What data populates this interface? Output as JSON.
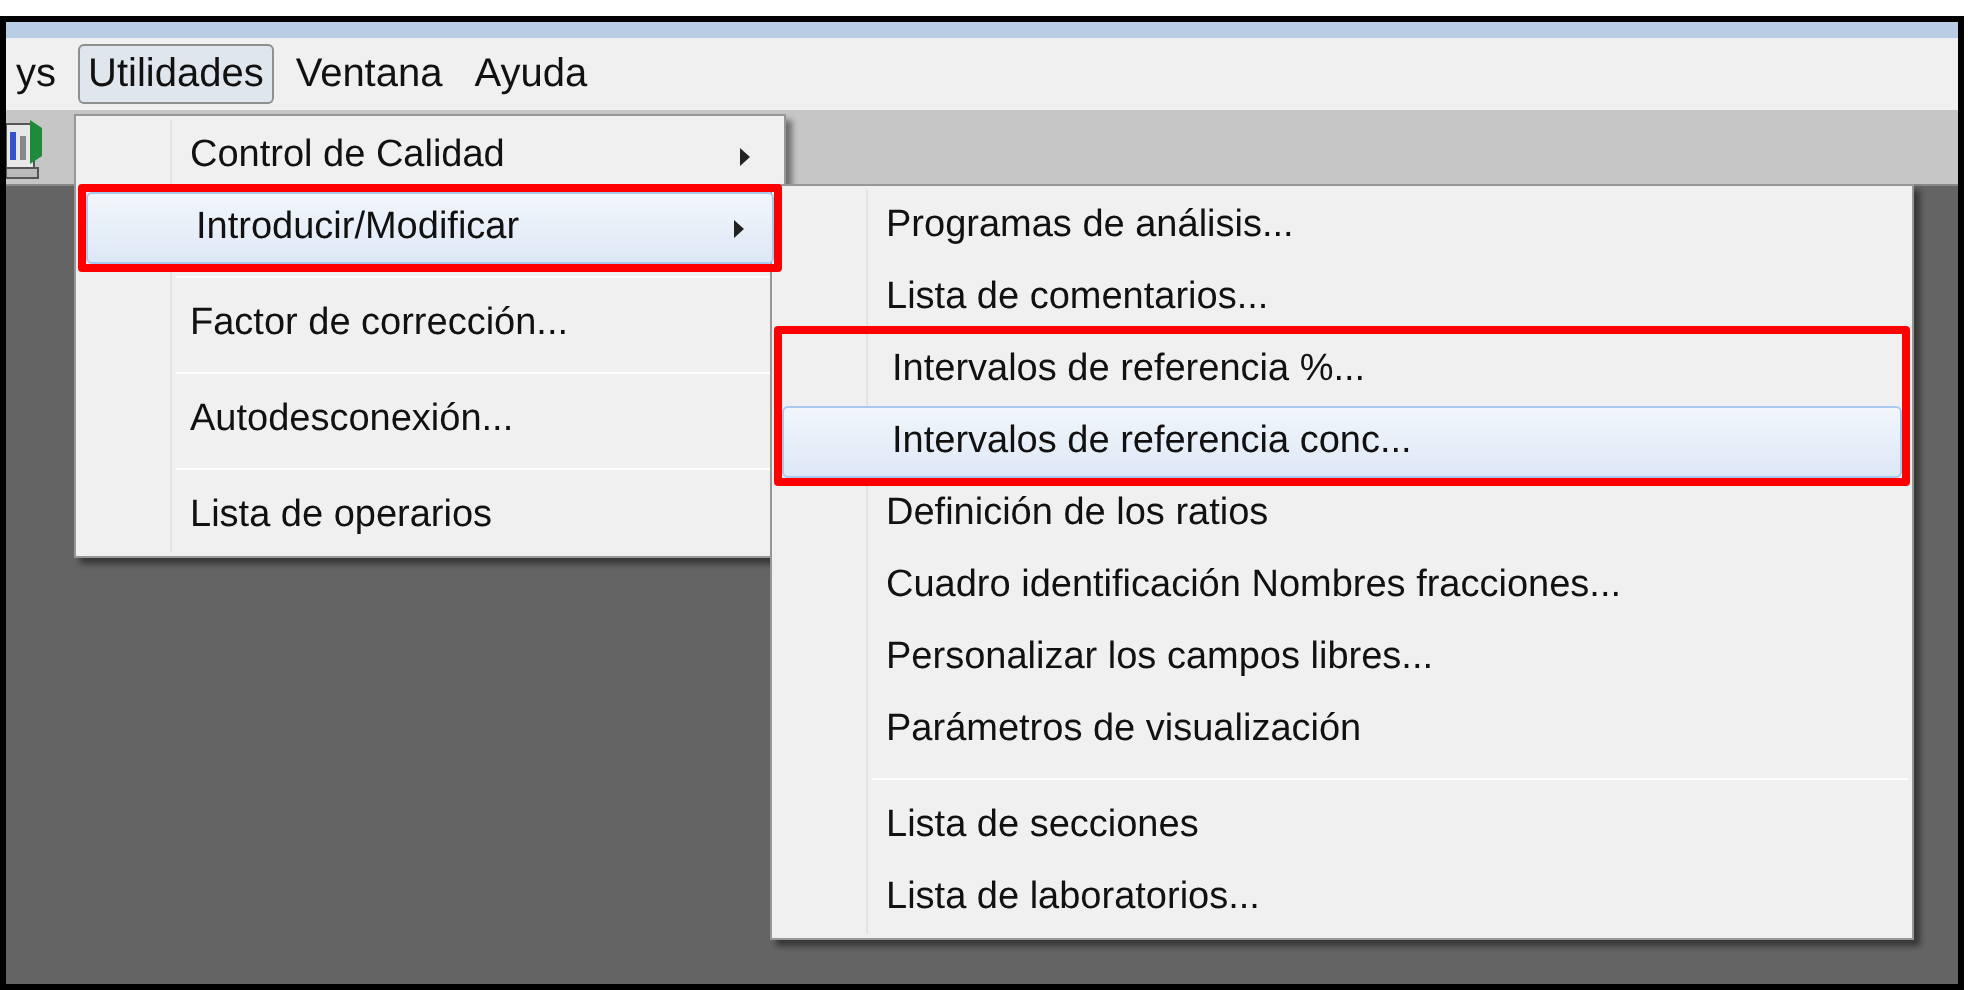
{
  "menubar": [
    {
      "label": "ys",
      "selected": false
    },
    {
      "label": "Utilidades",
      "selected": true
    },
    {
      "label": "Ventana",
      "selected": false
    },
    {
      "label": "Ayuda",
      "selected": false
    }
  ],
  "menu": {
    "items": [
      {
        "kind": "item",
        "label": "Control de Calidad",
        "selected": false,
        "has_submenu": true,
        "outlined": false
      },
      {
        "kind": "item",
        "label": "Introducir/Modificar",
        "selected": true,
        "has_submenu": true,
        "outlined": true
      },
      {
        "kind": "separator"
      },
      {
        "kind": "item",
        "label": "Factor de corrección...",
        "selected": false,
        "has_submenu": false,
        "outlined": false
      },
      {
        "kind": "separator"
      },
      {
        "kind": "item",
        "label": "Autodesconexión...",
        "selected": false,
        "has_submenu": false,
        "outlined": false
      },
      {
        "kind": "separator"
      },
      {
        "kind": "item",
        "label": "Lista de operarios",
        "selected": false,
        "has_submenu": false,
        "outlined": false
      }
    ]
  },
  "submenu": {
    "items": [
      {
        "kind": "item",
        "label": "Programas de análisis...",
        "selected": false,
        "outlined": false
      },
      {
        "kind": "item",
        "label": "Lista de comentarios...",
        "selected": false,
        "outlined": false
      },
      {
        "kind": "item",
        "label": "Intervalos de referencia %...",
        "selected": false,
        "outlined": true
      },
      {
        "kind": "item",
        "label": "Intervalos de referencia conc...",
        "selected": true,
        "outlined": true
      },
      {
        "kind": "item",
        "label": "Definición de los ratios",
        "selected": false,
        "outlined": false
      },
      {
        "kind": "item",
        "label": "Cuadro identificación Nombres fracciones...",
        "selected": false,
        "outlined": false
      },
      {
        "kind": "item",
        "label": "Personalizar los campos libres...",
        "selected": false,
        "outlined": false
      },
      {
        "kind": "item",
        "label": "Parámetros de visualización",
        "selected": false,
        "outlined": false
      },
      {
        "kind": "separator"
      },
      {
        "kind": "item",
        "label": "Lista de secciones",
        "selected": false,
        "outlined": false
      },
      {
        "kind": "item",
        "label": "Lista de laboratorios...",
        "selected": false,
        "outlined": false
      }
    ]
  }
}
